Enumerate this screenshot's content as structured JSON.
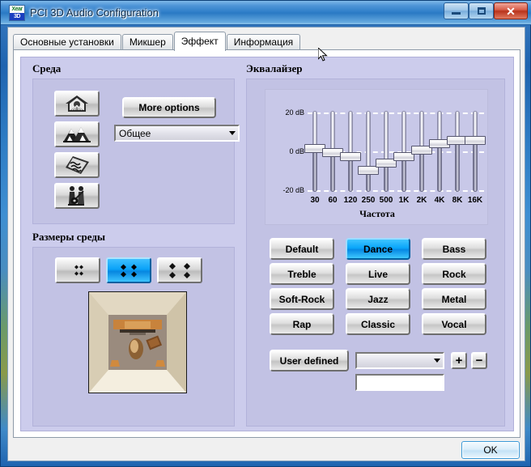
{
  "window": {
    "title": "PCI 3D Audio Configuration",
    "icon": "xear-3d-logo-icon",
    "logo_top": "Xear",
    "logo_bottom": "3D",
    "minimize_label": "–",
    "maximize_label": "□",
    "close_label": "✕"
  },
  "tabs": [
    {
      "label": "Основные установки",
      "active": false
    },
    {
      "label": "Микшер",
      "active": false
    },
    {
      "label": "Эффект",
      "active": true
    },
    {
      "label": "Информация",
      "active": false
    }
  ],
  "environment": {
    "title": "Среда",
    "more_options_label": "More options",
    "preset_combo": {
      "value": "Общее",
      "placeholder": "Общее"
    },
    "icon_buttons": [
      {
        "name": "environment-indoor-icon",
        "selected": false
      },
      {
        "name": "environment-mountains-icon",
        "selected": false
      },
      {
        "name": "environment-water-icon",
        "selected": false
      },
      {
        "name": "environment-concert-icon",
        "selected": false
      }
    ]
  },
  "room_size": {
    "title": "Размеры среды",
    "buttons": [
      {
        "name": "room-size-small",
        "selected": false
      },
      {
        "name": "room-size-medium",
        "selected": true
      },
      {
        "name": "room-size-large",
        "selected": false
      }
    ],
    "preview_name": "room-preview-image"
  },
  "equalizer": {
    "title": "Эквалайзер",
    "axis_labels": [
      "20 dB",
      "0  dB",
      "-20 dB"
    ],
    "frequency_axis_title": "Частота",
    "user_defined_label": "User defined",
    "add_label": "+",
    "remove_label": "−",
    "user_combo_value": "",
    "user_name_value": "",
    "presets": [
      {
        "label": "Default",
        "active": false
      },
      {
        "label": "Dance",
        "active": true
      },
      {
        "label": "Bass",
        "active": false
      },
      {
        "label": "Treble",
        "active": false
      },
      {
        "label": "Live",
        "active": false
      },
      {
        "label": "Rock",
        "active": false
      },
      {
        "label": "Soft-Rock",
        "active": false
      },
      {
        "label": "Jazz",
        "active": false
      },
      {
        "label": "Metal",
        "active": false
      },
      {
        "label": "Rap",
        "active": false
      },
      {
        "label": "Classic",
        "active": false
      },
      {
        "label": "Vocal",
        "active": false
      }
    ]
  },
  "footer": {
    "ok_label": "OK"
  },
  "colors": {
    "accent": "#0aa6fa",
    "panel": "#ccccec",
    "group": "#c2c2e4",
    "eq_box": "#c8c8e8",
    "title_bar": "#2f7ec8",
    "close_button": "#b8331c"
  },
  "chart_data": {
    "type": "bar",
    "title": "Эквалайзер",
    "subtitle": "Dance",
    "xlabel": "Частота",
    "ylabel": "dB",
    "ylim": [
      -20,
      20
    ],
    "ytick_labels": [
      "20 dB",
      "0  dB",
      "-20 dB"
    ],
    "yticks": [
      20,
      0,
      -20
    ],
    "grid": true,
    "legend": "none",
    "categories": [
      "30",
      "60",
      "120",
      "250",
      "500",
      "1K",
      "2K",
      "4K",
      "8K",
      "16K"
    ],
    "values": [
      4,
      2,
      0,
      -7,
      -3,
      0,
      3,
      6,
      7,
      7
    ]
  }
}
